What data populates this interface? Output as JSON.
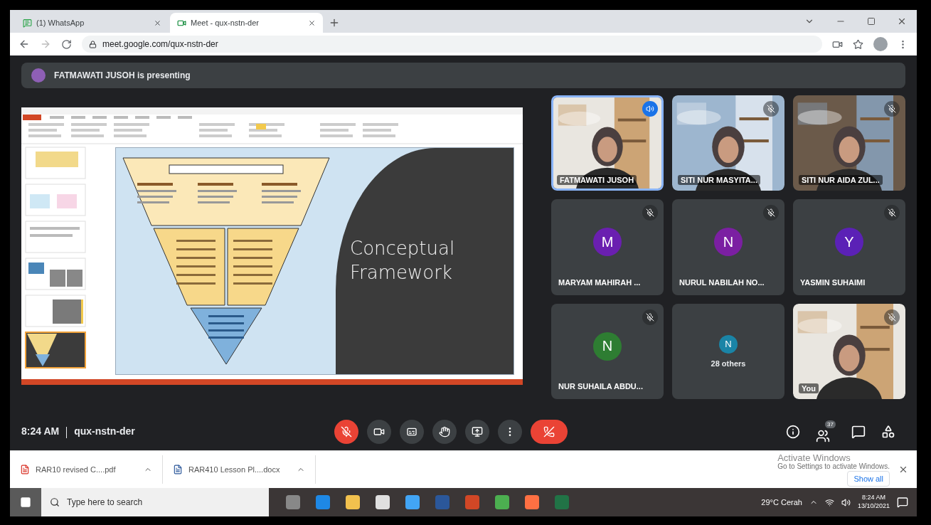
{
  "browser": {
    "tabs": [
      {
        "title": "(1) WhatsApp",
        "selected": false
      },
      {
        "title": "Meet - qux-nstn-der",
        "selected": true
      }
    ],
    "url": "meet.google.com/qux-nstn-der"
  },
  "meeting": {
    "presenting_banner": "FATMAWATI JUSOH is presenting",
    "slide": {
      "title_lines": [
        "Conceptual",
        "Framework"
      ]
    },
    "participants": [
      {
        "kind": "video",
        "name": "FATMAWATI JUSOH",
        "speaking": true,
        "muted": false
      },
      {
        "kind": "video",
        "name": "SITI NUR MASYITA...",
        "speaking": false,
        "muted": true
      },
      {
        "kind": "video",
        "name": "SITI NUR AIDA ZUL...",
        "speaking": false,
        "muted": true
      },
      {
        "kind": "avatar",
        "name": "MARYAM MAHIRAH ...",
        "initial": "M",
        "color": "#6a1fb0",
        "muted": true
      },
      {
        "kind": "avatar",
        "name": "NURUL NABILAH NO...",
        "initial": "N",
        "color": "#7b1fa2",
        "muted": true
      },
      {
        "kind": "avatar",
        "name": "YASMIN SUHAIMI",
        "initial": "Y",
        "color": "#5b21b6",
        "muted": true
      },
      {
        "kind": "avatar",
        "name": "NUR SUHAILA ABDU...",
        "initial": "N",
        "color": "#2e7d32",
        "muted": true
      },
      {
        "kind": "others",
        "name": "28 others",
        "initial": "N",
        "color": "#1a84a6"
      },
      {
        "kind": "video",
        "name": "You",
        "speaking": false,
        "muted": true
      }
    ],
    "time": "8:24 AM",
    "meeting_code": "qux-nstn-der",
    "mic_muted": true,
    "people_count": "37"
  },
  "downloads": {
    "items": [
      {
        "kind": "pdf",
        "name": "RAR10 revised C....pdf"
      },
      {
        "kind": "doc",
        "name": "RAR410 Lesson Pl....docx"
      }
    ],
    "show_all": "Show all"
  },
  "activation": {
    "title": "Activate Windows",
    "subtitle": "Go to Settings to activate Windows."
  },
  "taskbar": {
    "search_placeholder": "Type here to search",
    "weather": "29°C  Cerah",
    "time": "8:24 AM",
    "date": "13/10/2021"
  }
}
